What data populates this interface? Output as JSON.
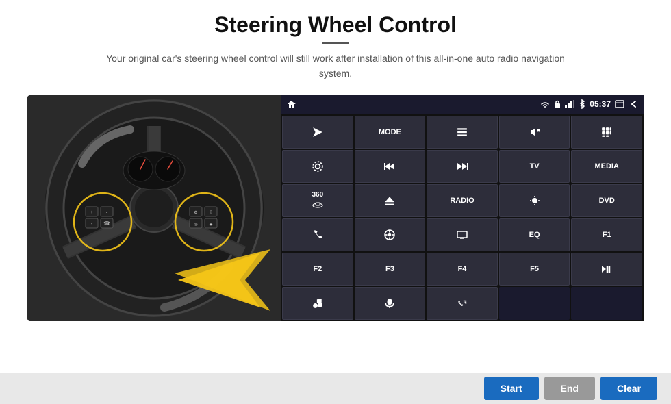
{
  "header": {
    "title": "Steering Wheel Control",
    "subtitle": "Your original car's steering wheel control will still work after installation of this all-in-one auto radio navigation system."
  },
  "status_bar": {
    "time": "05:37",
    "home_icon": "⌂",
    "wifi_icon": "wifi",
    "lock_icon": "lock",
    "signal_icon": "signal",
    "bluetooth_icon": "bluetooth",
    "window_icon": "window",
    "back_icon": "back"
  },
  "buttons": [
    {
      "id": "r1c1",
      "icon": "send",
      "label": "",
      "type": "icon"
    },
    {
      "id": "r1c2",
      "label": "MODE",
      "type": "text"
    },
    {
      "id": "r1c3",
      "icon": "list",
      "label": "",
      "type": "icon"
    },
    {
      "id": "r1c4",
      "icon": "mute",
      "label": "",
      "type": "icon"
    },
    {
      "id": "r1c5",
      "icon": "grid",
      "label": "",
      "type": "icon"
    },
    {
      "id": "r2c1",
      "icon": "settings",
      "label": "",
      "type": "icon"
    },
    {
      "id": "r2c2",
      "icon": "rewind",
      "label": "",
      "type": "icon"
    },
    {
      "id": "r2c3",
      "icon": "forward",
      "label": "",
      "type": "icon"
    },
    {
      "id": "r2c4",
      "label": "TV",
      "type": "text"
    },
    {
      "id": "r2c5",
      "label": "MEDIA",
      "type": "text"
    },
    {
      "id": "r3c1",
      "icon": "360",
      "label": "360",
      "type": "icon"
    },
    {
      "id": "r3c2",
      "icon": "eject",
      "label": "",
      "type": "icon"
    },
    {
      "id": "r3c3",
      "label": "RADIO",
      "type": "text"
    },
    {
      "id": "r3c4",
      "icon": "brightness",
      "label": "",
      "type": "icon"
    },
    {
      "id": "r3c5",
      "label": "DVD",
      "type": "text"
    },
    {
      "id": "r4c1",
      "icon": "phone",
      "label": "",
      "type": "icon"
    },
    {
      "id": "r4c2",
      "icon": "nav",
      "label": "",
      "type": "icon"
    },
    {
      "id": "r4c3",
      "icon": "screen",
      "label": "",
      "type": "icon"
    },
    {
      "id": "r4c4",
      "label": "EQ",
      "type": "text"
    },
    {
      "id": "r4c5",
      "label": "F1",
      "type": "text"
    },
    {
      "id": "r5c1",
      "label": "F2",
      "type": "text"
    },
    {
      "id": "r5c2",
      "label": "F3",
      "type": "text"
    },
    {
      "id": "r5c3",
      "label": "F4",
      "type": "text"
    },
    {
      "id": "r5c4",
      "label": "F5",
      "type": "text"
    },
    {
      "id": "r5c5",
      "icon": "playpause",
      "label": "",
      "type": "icon"
    },
    {
      "id": "r6c1",
      "icon": "music",
      "label": "",
      "type": "icon"
    },
    {
      "id": "r6c2",
      "icon": "mic",
      "label": "",
      "type": "icon"
    },
    {
      "id": "r6c3",
      "icon": "call",
      "label": "",
      "type": "icon"
    },
    {
      "id": "r6c4",
      "label": "",
      "type": "empty"
    },
    {
      "id": "r6c5",
      "label": "",
      "type": "empty"
    }
  ],
  "bottom_bar": {
    "start_label": "Start",
    "end_label": "End",
    "clear_label": "Clear"
  }
}
